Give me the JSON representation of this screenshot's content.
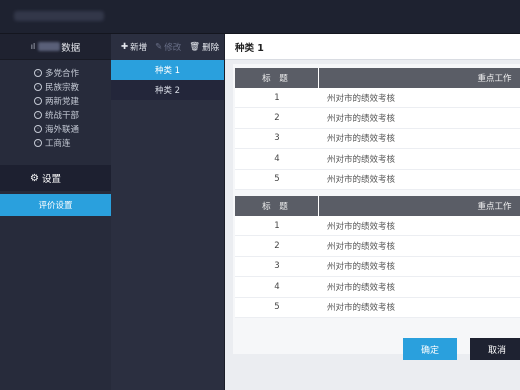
{
  "nav": {
    "header_label": "数据",
    "items": [
      {
        "label": "多党合作",
        "icon": "circle-icon"
      },
      {
        "label": "民族宗教",
        "icon": "circle-icon"
      },
      {
        "label": "两新党建",
        "icon": "circle-icon"
      },
      {
        "label": "统战干部",
        "icon": "circle-icon"
      },
      {
        "label": "海外联通",
        "icon": "circle-icon"
      },
      {
        "label": "工商连",
        "icon": "circle-icon"
      }
    ],
    "settings_label": "设置",
    "eval_label": "评价设置"
  },
  "toolbar": {
    "add_label": "新增",
    "edit_label": "修改",
    "delete_label": "删除"
  },
  "categories": [
    {
      "label": "种类 1"
    },
    {
      "label": "种类 2"
    }
  ],
  "main": {
    "title": "种类 1",
    "tables": [
      {
        "headers": [
          "标 题",
          "重点工作"
        ],
        "rows": [
          {
            "num": "1",
            "text": "州对市的绩效考核"
          },
          {
            "num": "2",
            "text": "州对市的绩效考核"
          },
          {
            "num": "3",
            "text": "州对市的绩效考核"
          },
          {
            "num": "4",
            "text": "州对市的绩效考核"
          },
          {
            "num": "5",
            "text": "州对市的绩效考核"
          }
        ]
      },
      {
        "headers": [
          "标 题",
          "重点工作"
        ],
        "rows": [
          {
            "num": "1",
            "text": "州对市的绩效考核"
          },
          {
            "num": "2",
            "text": "州对市的绩效考核"
          },
          {
            "num": "3",
            "text": "州对市的绩效考核"
          },
          {
            "num": "4",
            "text": "州对市的绩效考核"
          },
          {
            "num": "5",
            "text": "州对市的绩效考核"
          }
        ]
      }
    ],
    "confirm_label": "确定",
    "cancel_label": "取消"
  },
  "colors": {
    "accent": "#2aa0dd",
    "dark_bg": "#272b3b",
    "table_header": "#5a5d66"
  }
}
